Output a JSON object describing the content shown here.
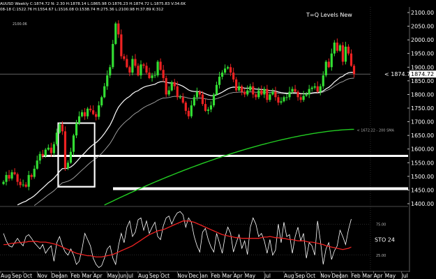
{
  "header": {
    "line1": "AUUSD Weekly  C:1874.72  N:  2.30  H:1878.14  L:1865.98  O:1876.23  H:1874.72  L:1875.83  V:34.6K",
    "line2": "08-18  C:1522.76  H:1554.67  L:1516.08  O:1538.74  H:275.36  L:2100.98  H:37.89  K:312",
    "line3": "2100.06"
  },
  "chart_data": [
    {
      "type": "candlestick",
      "title": "T=Q Levels New",
      "xlabel": "",
      "ylabel": "",
      "y_axis_side": "right",
      "ylim": [
        1400,
        2100
      ],
      "y_ticks": [
        1400,
        1450,
        1500,
        1550,
        1600,
        1650,
        1700,
        1750,
        1800,
        1850,
        1900,
        1950,
        2000,
        2050,
        2100
      ],
      "last_price": 1874.72,
      "last_price_label": "< 1874.7",
      "last_price_tag": "1874.72",
      "bull_color": "#33dd33",
      "bear_color": "#ee2222",
      "close": [
        1480,
        1505,
        1492,
        1515,
        1508,
        1480,
        1468,
        1470,
        1462,
        1505,
        1498,
        1528,
        1558,
        1582,
        1575,
        1598,
        1605,
        1585,
        1618,
        1660,
        1690,
        1665,
        1530,
        1550,
        1590,
        1650,
        1695,
        1720,
        1735,
        1720,
        1748,
        1742,
        1728,
        1718,
        1760,
        1790,
        1830,
        1870,
        1900,
        1985,
        2060,
        2020,
        1940,
        1930,
        1900,
        1880,
        1930,
        1905,
        1870,
        1910,
        1905,
        1880,
        1860,
        1870,
        1870,
        1920,
        1890,
        1860,
        1800,
        1815,
        1845,
        1830,
        1790,
        1790,
        1770,
        1740,
        1720,
        1760,
        1790,
        1810,
        1800,
        1765,
        1740,
        1745,
        1760,
        1800,
        1835,
        1865,
        1880,
        1895,
        1900,
        1880,
        1855,
        1815,
        1830,
        1810,
        1800,
        1815,
        1830,
        1800,
        1790,
        1815,
        1800,
        1820,
        1780,
        1800,
        1810,
        1790,
        1770,
        1775,
        1790,
        1790,
        1810,
        1820,
        1810,
        1790,
        1780,
        1795,
        1800,
        1820,
        1825,
        1830,
        1810,
        1830,
        1870,
        1920,
        1900,
        1950,
        1990,
        1960,
        1980,
        1920,
        1975,
        1950,
        1905,
        1875
      ],
      "moving_averages": [
        {
          "style": "white",
          "smoothing": 0.07
        },
        {
          "style": "grey",
          "smoothing": 0.045
        },
        {
          "style": "green",
          "label": "< 1672.22 - 200 SMA",
          "start": 1395,
          "end": 1672.22
        }
      ],
      "levels": [
        {
          "value": 1575
        },
        {
          "value": 1455
        }
      ],
      "boxes": [
        {
          "x_from_week": 20,
          "x_to_week": 32,
          "y_from": 1462,
          "y_to": 1695
        },
        {
          "x_from_week": 20,
          "x_to_week": 32,
          "y_from": 1462,
          "y_to": 1575
        }
      ]
    },
    {
      "type": "line",
      "title": "",
      "label": "STO",
      "label_value": "24",
      "ylim": [
        0,
        100
      ],
      "y_ticks": [
        25,
        75
      ],
      "y_tick_labels": [
        "25.00",
        "75.00"
      ],
      "series": [
        {
          "color": "#ffffff",
          "values": [
            60,
            48,
            40,
            38,
            45,
            52,
            45,
            40,
            55,
            58,
            52,
            45,
            40,
            35,
            42,
            28,
            35,
            40,
            15,
            45,
            55,
            40,
            30,
            25,
            35,
            25,
            10,
            15,
            35,
            60,
            50,
            40,
            20,
            10,
            5,
            8,
            20,
            35,
            40,
            20,
            10,
            40,
            60,
            45,
            70,
            80,
            55,
            62,
            82,
            85,
            65,
            80,
            60,
            70,
            78,
            55,
            50,
            72,
            85,
            88,
            75,
            86,
            93,
            95,
            90,
            70,
            85,
            78,
            55,
            40,
            30,
            62,
            68,
            50,
            38,
            30,
            60,
            45,
            28,
            55,
            70,
            60,
            30,
            45,
            58,
            36,
            48,
            26,
            70,
            85,
            75,
            55,
            60,
            48,
            28,
            50,
            25,
            33,
            75,
            45,
            78,
            55,
            58,
            28,
            55,
            70,
            48,
            60,
            20,
            45,
            40,
            25,
            80,
            48,
            10,
            35,
            45,
            18,
            32,
            40,
            65,
            55,
            42,
            66,
            83
          ]
        },
        {
          "color": "#ee2222",
          "values": [
            42,
            42,
            43,
            44,
            44,
            45,
            45,
            46,
            46,
            47,
            47,
            47,
            47,
            46,
            46,
            46,
            45,
            44,
            43,
            42,
            40,
            38,
            36,
            34,
            32,
            30,
            28,
            27,
            26,
            25,
            24,
            24,
            23,
            22,
            22,
            22,
            23,
            24,
            25,
            26,
            28,
            30,
            32,
            34,
            36,
            38,
            40,
            43,
            46,
            49,
            52,
            55,
            58,
            60,
            62,
            64,
            65,
            66,
            68,
            70,
            72,
            74,
            76,
            78,
            80,
            80,
            80,
            79,
            78,
            76,
            74,
            72,
            70,
            68,
            66,
            64,
            62,
            60,
            58,
            57,
            56,
            55,
            54,
            53,
            53,
            52,
            52,
            52,
            52,
            52,
            52,
            52,
            53,
            54,
            54,
            55,
            54,
            53,
            53,
            52,
            52,
            51,
            50,
            50,
            49,
            48,
            48,
            48,
            47,
            46,
            46,
            45,
            44,
            43,
            42,
            40,
            39,
            38,
            37,
            36,
            35,
            34,
            35,
            36,
            38
          ]
        }
      ]
    }
  ],
  "x_axis": {
    "labels": [
      "Aug",
      "Sep",
      "Oct",
      "Nov",
      "Dec",
      "Jan",
      "Feb",
      "Mar",
      "Apr",
      "May",
      "Jun",
      "Jul",
      "Aug",
      "Sep",
      "Oct",
      "Nov",
      "Dec",
      "Jan",
      "Feb",
      "Mar",
      "Apr",
      "May",
      "Jul",
      "Aug",
      "Sep",
      "Oct",
      "Nov",
      "Dec",
      "Jan",
      "Feb",
      "Mar",
      "Apr",
      "May",
      "Jul",
      "Aug",
      "Sep"
    ],
    "weeks": [
      -1,
      3,
      7,
      12,
      17,
      20,
      24,
      28,
      32,
      37,
      41,
      44,
      48,
      52,
      56,
      62,
      66,
      70,
      74,
      78,
      82,
      86,
      93,
      100,
      104,
      108,
      113,
      117,
      120,
      124,
      128,
      132,
      136,
      142,
      150,
      154
    ]
  }
}
